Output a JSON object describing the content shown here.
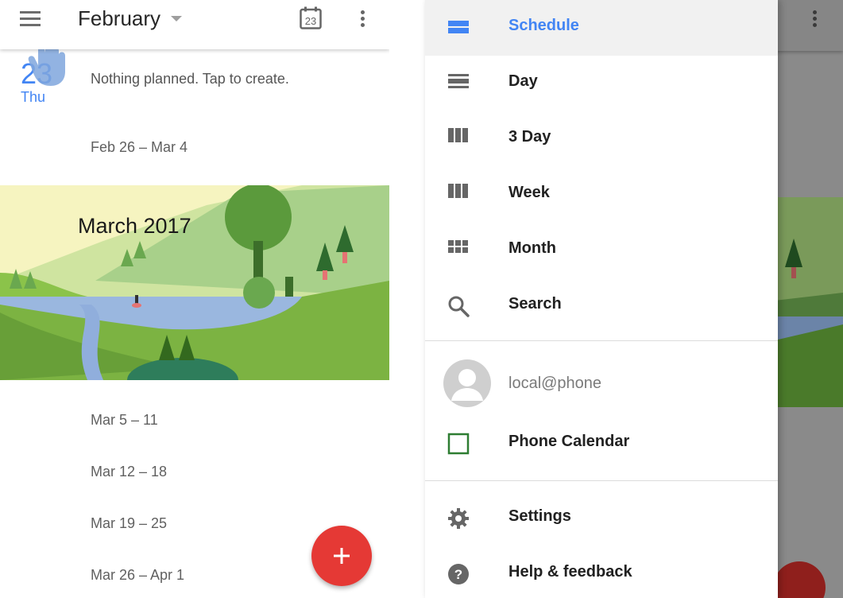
{
  "header": {
    "month": "February",
    "today_icon_day": "23"
  },
  "schedule": {
    "today": {
      "day_number": "23",
      "day_name": "Thu",
      "event_text": "Nothing planned. Tap to create."
    },
    "weeks_before_banner": [
      "Feb 26 – Mar 4"
    ],
    "banner_title": "March 2017",
    "weeks_after_banner": [
      "Mar 5 – 11",
      "Mar 12 – 18",
      "Mar 19 – 25",
      "Mar 26 – Apr 1"
    ]
  },
  "drawer": {
    "views": [
      {
        "label": "Schedule",
        "icon": "schedule-view-icon",
        "active": true
      },
      {
        "label": "Day",
        "icon": "day-view-icon",
        "active": false
      },
      {
        "label": "3 Day",
        "icon": "three-day-view-icon",
        "active": false
      },
      {
        "label": "Week",
        "icon": "week-view-icon",
        "active": false
      },
      {
        "label": "Month",
        "icon": "month-view-icon",
        "active": false
      },
      {
        "label": "Search",
        "icon": "search-icon",
        "active": false
      }
    ],
    "account": "local@phone",
    "calendars": [
      {
        "label": "Phone Calendar",
        "icon": "checkbox-icon",
        "color": "#2e7d32"
      }
    ],
    "footer": [
      {
        "label": "Settings",
        "icon": "gear-icon"
      },
      {
        "label": "Help & feedback",
        "icon": "help-icon"
      }
    ]
  },
  "colors": {
    "accent": "#4285f4",
    "fab": "#e53935",
    "text": "#212121"
  }
}
